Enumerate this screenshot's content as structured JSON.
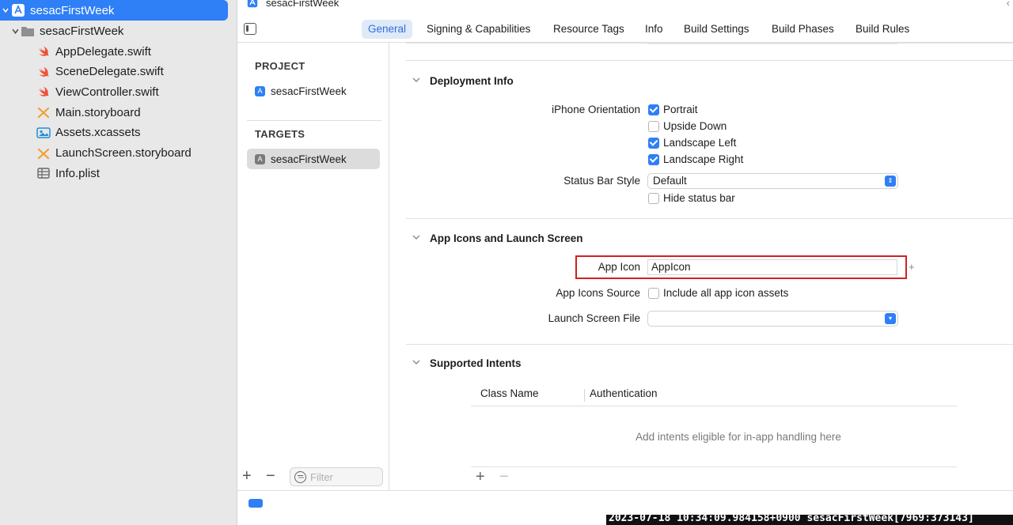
{
  "navigator": {
    "project_root": "sesacFirstWeek",
    "group": "sesacFirstWeek",
    "files": [
      {
        "name": "AppDelegate.swift",
        "icon": "swift-file-icon"
      },
      {
        "name": "SceneDelegate.swift",
        "icon": "swift-file-icon"
      },
      {
        "name": "ViewController.swift",
        "icon": "swift-file-icon"
      },
      {
        "name": "Main.storyboard",
        "icon": "storyboard-icon"
      },
      {
        "name": "Assets.xcassets",
        "icon": "asset-catalog-icon"
      },
      {
        "name": "LaunchScreen.storyboard",
        "icon": "storyboard-icon"
      },
      {
        "name": "Info.plist",
        "icon": "plist-icon"
      }
    ]
  },
  "header": {
    "breadcrumb": "sesacFirstWeek"
  },
  "tabs": [
    "General",
    "Signing & Capabilities",
    "Resource Tags",
    "Info",
    "Build Settings",
    "Build Phases",
    "Build Rules"
  ],
  "active_tab": "General",
  "targets_pane": {
    "project_header": "PROJECT",
    "project_item": "sesacFirstWeek",
    "targets_header": "TARGETS",
    "target_item": "sesacFirstWeek",
    "filter_placeholder": "Filter"
  },
  "deployment_info": {
    "title": "Deployment Info",
    "orientation_label": "iPhone Orientation",
    "orientations": [
      {
        "label": "Portrait",
        "checked": true
      },
      {
        "label": "Upside Down",
        "checked": false
      },
      {
        "label": "Landscape Left",
        "checked": true
      },
      {
        "label": "Landscape Right",
        "checked": true
      }
    ],
    "status_bar_label": "Status Bar Style",
    "status_bar_value": "Default",
    "hide_status_bar_label": "Hide status bar",
    "hide_status_bar_checked": false
  },
  "app_icons": {
    "title": "App Icons and Launch Screen",
    "app_icon_label": "App Icon",
    "app_icon_value": "AppIcon",
    "icons_source_label": "App Icons Source",
    "include_all_label": "Include all app icon assets",
    "include_all_checked": false,
    "launch_screen_label": "Launch Screen File",
    "launch_screen_value": ""
  },
  "supported_intents": {
    "title": "Supported Intents",
    "columns": [
      "Class Name",
      "Authentication"
    ],
    "empty_message": "Add intents eligible for in-app handling here"
  },
  "console": {
    "text": "2023-07-18 10:34:09.984158+0900 sesacFirstWeek[7969:373143]"
  },
  "colors": {
    "accent": "#2f7ff6",
    "highlight_border": "#d32020"
  }
}
